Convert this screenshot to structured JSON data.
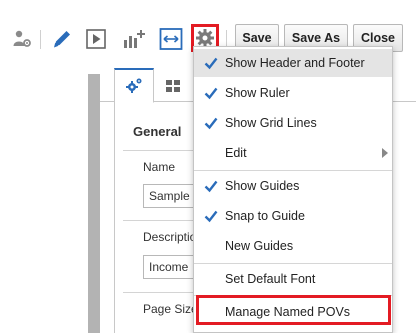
{
  "toolbar": {
    "icons": [
      "user-gear-icon",
      "pencil-icon",
      "play-icon",
      "add-chart-icon",
      "fit-width-icon",
      "gear-icon"
    ],
    "save_label": "Save",
    "save_as_label": "Save As",
    "close_label": "Close"
  },
  "panel": {
    "tabs": [
      "layout-settings-tab-icon",
      "grid-tab-icon"
    ],
    "general_title": "General",
    "fields": [
      {
        "label": "Name",
        "value": "Sample"
      },
      {
        "label": "Description",
        "value": "Income"
      },
      {
        "label": "Page Size",
        "value": ""
      }
    ]
  },
  "menu": {
    "items": [
      {
        "label": "Show Header and Footer",
        "checked": true,
        "highlighted": true
      },
      {
        "label": "Show Ruler",
        "checked": true
      },
      {
        "label": "Show Grid Lines",
        "checked": true
      },
      {
        "label": "Edit",
        "checked": false,
        "submenu": true
      },
      {
        "label": "Show Guides",
        "checked": true
      },
      {
        "label": "Snap to Guide",
        "checked": true
      },
      {
        "label": "New Guides",
        "checked": false
      },
      {
        "label": "Set Default Font",
        "checked": false
      },
      {
        "label": "Manage Named POVs",
        "checked": false,
        "outlined": true
      }
    ]
  },
  "colors": {
    "accent_blue": "#2a6cba",
    "highlight_red": "#e31b23",
    "menu_hover": "#e4e4e4"
  }
}
